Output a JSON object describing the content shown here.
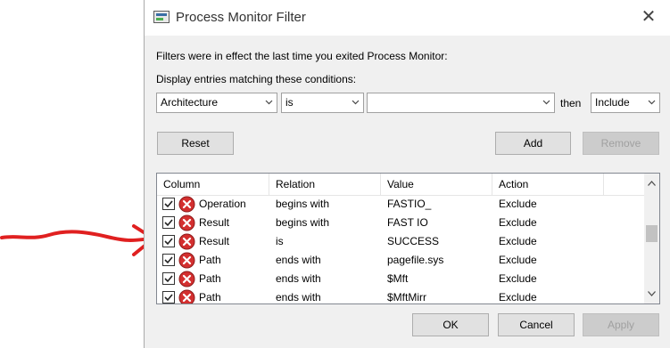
{
  "window": {
    "title": "Process Monitor Filter"
  },
  "info_text": "Filters were in effect the last time you exited Process Monitor:",
  "conditions_label": "Display entries matching these conditions:",
  "filter_row": {
    "column_value": "Architecture",
    "relation_value": "is",
    "value_value": "",
    "then_label": "then",
    "action_value": "Include"
  },
  "buttons": {
    "reset": "Reset",
    "add": "Add",
    "remove": "Remove",
    "ok": "OK",
    "cancel": "Cancel",
    "apply": "Apply"
  },
  "table": {
    "headers": [
      "Column",
      "Relation",
      "Value",
      "Action"
    ],
    "rows": [
      {
        "checked": true,
        "column": "Operation",
        "relation": "begins with",
        "value": "FASTIO_",
        "action": "Exclude"
      },
      {
        "checked": true,
        "column": "Result",
        "relation": "begins with",
        "value": "FAST IO",
        "action": "Exclude"
      },
      {
        "checked": true,
        "column": "Result",
        "relation": "is",
        "value": "SUCCESS",
        "action": "Exclude"
      },
      {
        "checked": true,
        "column": "Path",
        "relation": "ends with",
        "value": "pagefile.sys",
        "action": "Exclude"
      },
      {
        "checked": true,
        "column": "Path",
        "relation": "ends with",
        "value": "$Mft",
        "action": "Exclude"
      },
      {
        "checked": true,
        "column": "Path",
        "relation": "ends with",
        "value": "$MftMirr",
        "action": "Exclude"
      }
    ]
  },
  "icons": {
    "app": "process-monitor-icon",
    "close": "close-icon",
    "row_status": "exclude-x-icon",
    "annotation": "red-arrow-annotation"
  },
  "colors": {
    "exclude_icon": "#d32f2f",
    "annotation": "#e02020"
  }
}
